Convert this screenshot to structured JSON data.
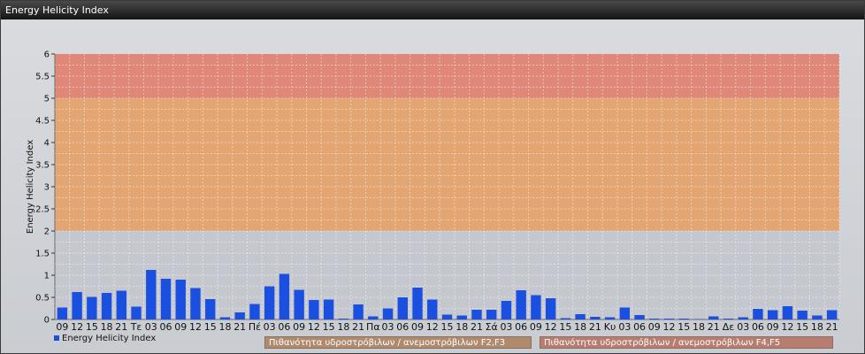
{
  "window": {
    "title": "Energy Helicity Index"
  },
  "chart_data": {
    "type": "bar",
    "ylabel": "Energy Helicity Index",
    "ylim": [
      0,
      6
    ],
    "yticks": [
      "0",
      "0.5",
      "1",
      "1.5",
      "2",
      "2.5",
      "3",
      "3.5",
      "4",
      "4.5",
      "5",
      "5.5",
      "6"
    ],
    "categories": [
      "09",
      "12",
      "15",
      "18",
      "21",
      "Τε",
      "03",
      "06",
      "09",
      "12",
      "15",
      "18",
      "21",
      "Πέ",
      "03",
      "06",
      "09",
      "12",
      "15",
      "18",
      "21",
      "Πα",
      "03",
      "06",
      "09",
      "12",
      "15",
      "18",
      "21",
      "Σά",
      "03",
      "06",
      "09",
      "12",
      "15",
      "18",
      "21",
      "Κυ",
      "03",
      "06",
      "09",
      "12",
      "15",
      "18",
      "21",
      "Δε",
      "03",
      "06",
      "09",
      "12",
      "15",
      "18",
      "21"
    ],
    "series": [
      {
        "name": "Energy Helicity Index",
        "color": "#1a4fe0",
        "values": [
          0.27,
          0.62,
          0.51,
          0.6,
          0.65,
          0.29,
          1.12,
          0.92,
          0.9,
          0.71,
          0.46,
          0.05,
          0.16,
          0.35,
          0.75,
          1.03,
          0.67,
          0.44,
          0.45,
          0.02,
          0.34,
          0.07,
          0.25,
          0.5,
          0.72,
          0.45,
          0.11,
          0.09,
          0.22,
          0.22,
          0.42,
          0.66,
          0.55,
          0.48,
          0.03,
          0.12,
          0.06,
          0.05,
          0.27,
          0.1,
          0.02,
          0.02,
          0.02,
          0.01,
          0.07,
          0.02,
          0.05,
          0.24,
          0.21,
          0.3,
          0.2,
          0.09,
          0.21
        ]
      }
    ],
    "bands": [
      {
        "from": 2,
        "to": 5,
        "color": "#e5a36b",
        "label": "Πιθανότητα υδροστρόβιλων / ανεμοστρόβιλων F2,F3"
      },
      {
        "from": 5,
        "to": 6,
        "color": "#e08572",
        "label": "Πιθανότητα υδροστρόβιλων / ανεμοστρόβιλων F4,F5"
      }
    ],
    "grid": true,
    "legend_position": "bottom"
  }
}
